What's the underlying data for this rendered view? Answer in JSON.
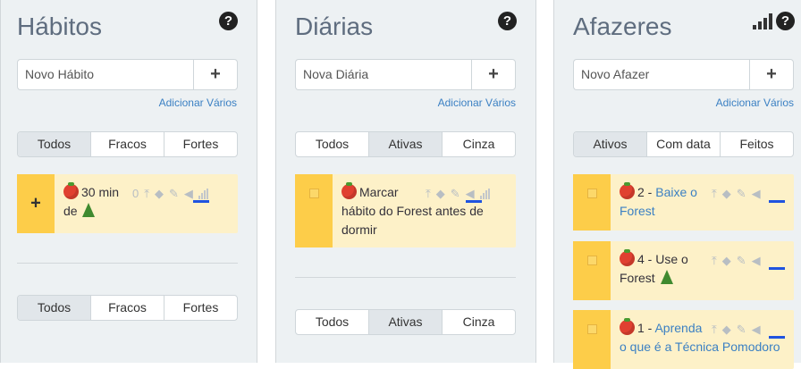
{
  "habits": {
    "title": "Hábitos",
    "input_placeholder": "Novo Hábito",
    "add_multiple": "Adicionar Vários",
    "filters": [
      "Todos",
      "Fracos",
      "Fortes"
    ],
    "active_filter": "Todos",
    "task": {
      "text_line1": "30 min",
      "text_line2": "de",
      "count": "0"
    }
  },
  "dailies": {
    "title": "Diárias",
    "input_placeholder": "Nova Diária",
    "add_multiple": "Adicionar Vários",
    "filters": [
      "Todos",
      "Ativas",
      "Cinza"
    ],
    "active_filter": "Ativas",
    "task": {
      "line1": "Marcar",
      "line2": "hábito do Forest antes de",
      "line3": "dormir"
    }
  },
  "todos": {
    "title": "Afazeres",
    "input_placeholder": "Novo Afazer",
    "add_multiple": "Adicionar Vários",
    "filters": [
      "Ativos",
      "Com data",
      "Feitos"
    ],
    "active_filter": "Ativos",
    "tasks": [
      {
        "prefix": "2 - ",
        "link1": "Baixe o",
        "link2": "Forest",
        "plain": ""
      },
      {
        "prefix": "4 - Use o",
        "link1": "",
        "link2": "",
        "plain": "Forest"
      },
      {
        "prefix": "1 - ",
        "link1": "Aprenda",
        "link2": "o que é a Técnica Pomodoro",
        "plain": ""
      }
    ]
  },
  "icons": {
    "help": "question-circle-icon",
    "add": "plus-icon",
    "upload": "push-to-top-icon",
    "tags": "tags-icon",
    "edit": "pencil-icon",
    "challenge": "megaphone-icon",
    "difficulty": "signal-bars-icon"
  },
  "colors": {
    "accent_blue": "#3b80c3",
    "task_bg": "#fdf1c8",
    "task_left": "#fdcd49",
    "panel_bg": "#edf1f3",
    "challenge_bar": "#1f53e0"
  }
}
